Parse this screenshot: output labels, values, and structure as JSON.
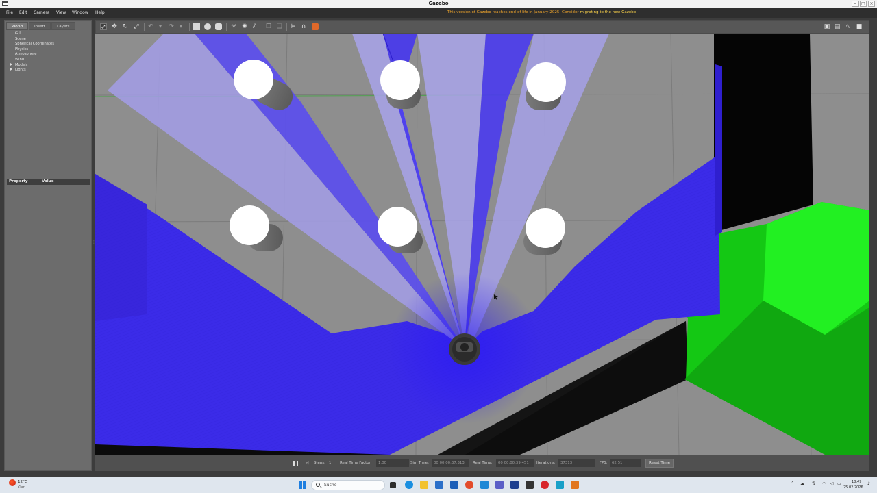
{
  "window": {
    "title": "Gazebo"
  },
  "menu": {
    "items": [
      "File",
      "Edit",
      "Camera",
      "View",
      "Window",
      "Help"
    ],
    "eol_notice_prefix": "This version of Gazebo reaches end-of-life in January 2025. Consider ",
    "eol_notice_link": "migrating to the new Gazebo"
  },
  "left_panel": {
    "tabs": [
      "World",
      "Insert",
      "Layers"
    ],
    "active_tab": "World",
    "tree": [
      "GUI",
      "Scene",
      "Spherical Coordinates",
      "Physics",
      "Atmosphere",
      "Wind",
      "Models",
      "Lights"
    ],
    "property_header": {
      "property": "Property",
      "value": "Value"
    }
  },
  "toolbar": {
    "tools": [
      "select-mode",
      "translate-mode",
      "rotate-mode",
      "scale-mode",
      "undo",
      "redo",
      "box-shape",
      "sphere-shape",
      "cylinder-shape",
      "point-light",
      "spot-light",
      "directional-light",
      "copy",
      "paste",
      "align",
      "snap",
      "change-view"
    ]
  },
  "bottom_bar": {
    "steps_label": "Steps:",
    "steps_value": "1",
    "real_time_factor_label": "Real Time Factor:",
    "real_time_factor_value": "1.00",
    "sim_time_label": "Sim Time:",
    "sim_time_value": "00 00:00:37.313",
    "real_time_label": "Real Time:",
    "real_time_value": "00 00:00:39.451",
    "iterations_label": "Iterations:",
    "iterations_value": "37313",
    "fps_label": "FPS:",
    "fps_value": "62.51",
    "reset_label": "Reset Time"
  },
  "taskbar": {
    "weather_temp": "12°C",
    "weather_desc": "Klar",
    "search_placeholder": "Suche",
    "clock_time": "18:49",
    "clock_date": "25.02.2026"
  },
  "colors": {
    "laser_blue": "#3b2be8",
    "obstacle_green": "#18e418",
    "ground_gray": "#8d8d8d",
    "eol_orange": "#f0a52b"
  }
}
